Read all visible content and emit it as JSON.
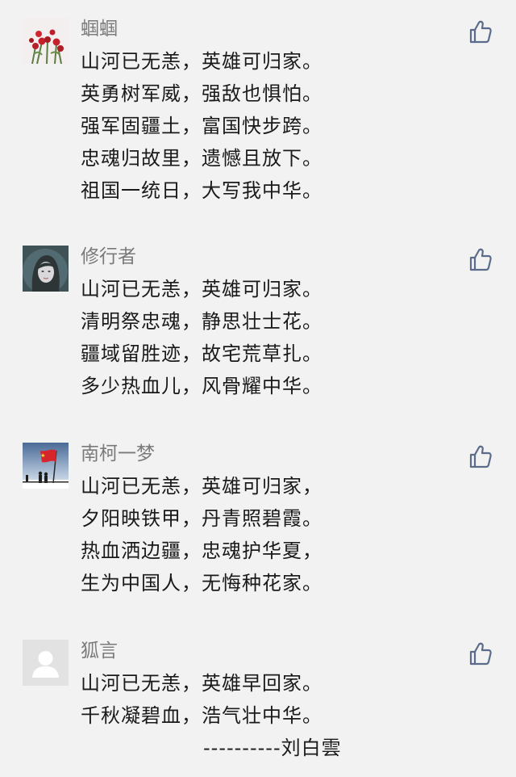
{
  "comments": [
    {
      "author": "蝈蝈",
      "avatar_icon": "red-roses-avatar-icon",
      "lines": [
        "山河已无恙，英雄可归家。",
        "英勇树军威，强敌也惧怕。",
        "强军固疆土，富国快步跨。",
        "忠魂归故里，遗憾且放下。",
        "祖国一统日，大写我中华。"
      ]
    },
    {
      "author": "修行者",
      "avatar_icon": "woman-portrait-avatar-icon",
      "lines": [
        "山河已无恙，英雄可归家。",
        "清明祭忠魂，静思壮士花。",
        "疆域留胜迹，故宅荒草扎。",
        "多少热血儿，风骨耀中华。"
      ]
    },
    {
      "author": "南柯一梦",
      "avatar_icon": "flag-soldiers-avatar-icon",
      "lines": [
        "山河已无恙，英雄可归家，",
        "夕阳映铁甲，丹青照碧霞。",
        "热血洒边疆，忠魂护华夏，",
        "生为中国人，无悔种花家。"
      ]
    },
    {
      "author": "狐言",
      "avatar_icon": "default-user-avatar-icon",
      "lines": [
        "山河已无恙，英雄早回家。",
        "千秋凝碧血，浩气壮中华。"
      ],
      "signature": "----------刘白雲"
    }
  ],
  "like_icon": "thumbs-up-icon",
  "colors": {
    "background": "#f2f2f2",
    "name": "#7a7a7a",
    "text": "#1a1a1a",
    "like": "#5b6b8c"
  }
}
